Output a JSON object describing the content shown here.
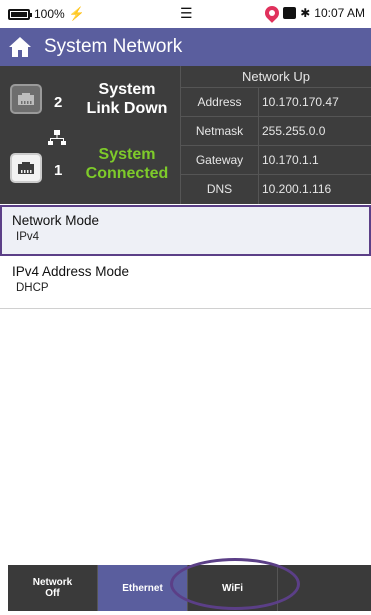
{
  "status_bar": {
    "battery": "100%",
    "charging_icon": "lightning-icon",
    "time": "10:07 AM"
  },
  "header": {
    "title": "System Network",
    "home_icon": "home-icon"
  },
  "ports": {
    "port2": {
      "number": "2",
      "status": "System Link Down",
      "status_line1": "System",
      "status_line2": "Link Down"
    },
    "port1": {
      "number": "1",
      "status_line1": "System",
      "status_line2": "Connected"
    }
  },
  "network": {
    "header": "Network Up",
    "rows": [
      {
        "key": "Address",
        "value": "10.170.170.47"
      },
      {
        "key": "Netmask",
        "value": "255.255.0.0"
      },
      {
        "key": "Gateway",
        "value": "10.170.1.1"
      },
      {
        "key": "DNS",
        "value": "10.200.1.116"
      }
    ]
  },
  "settings": [
    {
      "title": "Network Mode",
      "value": "IPv4"
    },
    {
      "title": "IPv4 Address Mode",
      "value": "DHCP"
    }
  ],
  "bottom_nav": {
    "network_off_line1": "Network",
    "network_off_line2": "Off",
    "ethernet": "Ethernet",
    "wifi": "WiFi"
  },
  "colors": {
    "header": "#5a5e9e",
    "connected": "#7ecb2a",
    "highlight": "#5b3f87"
  }
}
